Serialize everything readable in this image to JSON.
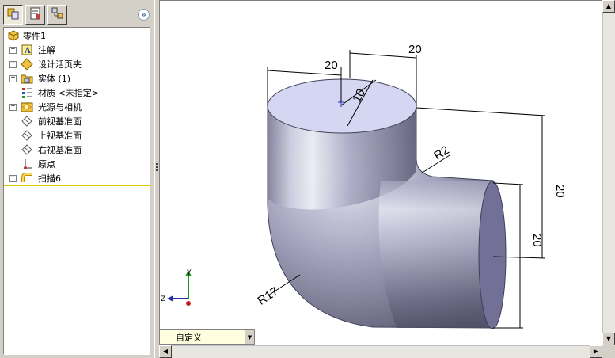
{
  "feature_manager": {
    "tabs": [
      {
        "icon": "feature-tree-icon",
        "active": true
      },
      {
        "icon": "property-manager-icon",
        "active": false
      },
      {
        "icon": "configuration-manager-icon",
        "active": false
      }
    ],
    "collapse_glyph": "»",
    "root": {
      "label": "零件1",
      "icon": "part-icon"
    },
    "items": [
      {
        "label": "注解",
        "icon": "annotations-icon",
        "expandable": true
      },
      {
        "label": "设计活页夹",
        "icon": "design-binder-icon",
        "expandable": true
      },
      {
        "label": "实体 (1)",
        "icon": "solid-bodies-icon",
        "expandable": true
      },
      {
        "label": "材质 <未指定>",
        "icon": "material-icon",
        "expandable": false
      },
      {
        "label": "光源与相机",
        "icon": "lights-cameras-icon",
        "expandable": true
      },
      {
        "label": "前视基准面",
        "icon": "plane-icon",
        "expandable": false
      },
      {
        "label": "上视基准面",
        "icon": "plane-icon",
        "expandable": false
      },
      {
        "label": "右视基准面",
        "icon": "plane-icon",
        "expandable": false
      },
      {
        "label": "原点",
        "icon": "origin-icon",
        "expandable": false
      },
      {
        "label": "扫描6",
        "icon": "sweep-feature-icon",
        "expandable": true
      }
    ]
  },
  "viewport": {
    "dimensions": {
      "top_width_left": "20",
      "top_width_right": "20",
      "inner_diameter": "10",
      "bend_radius_inner": "R2",
      "bend_radius_outer": "R17",
      "vertical_right": "20",
      "end_diameter": "20"
    },
    "triad": {
      "y": "Y",
      "z": "Z"
    },
    "colors": {
      "body_light": "#e4e4f0",
      "body_mid": "#a8a8c4",
      "body_dark": "#4e4e66",
      "face_top": "#d4d6f2",
      "face_end": "#727096"
    }
  },
  "configuration": {
    "label": "自定义"
  }
}
